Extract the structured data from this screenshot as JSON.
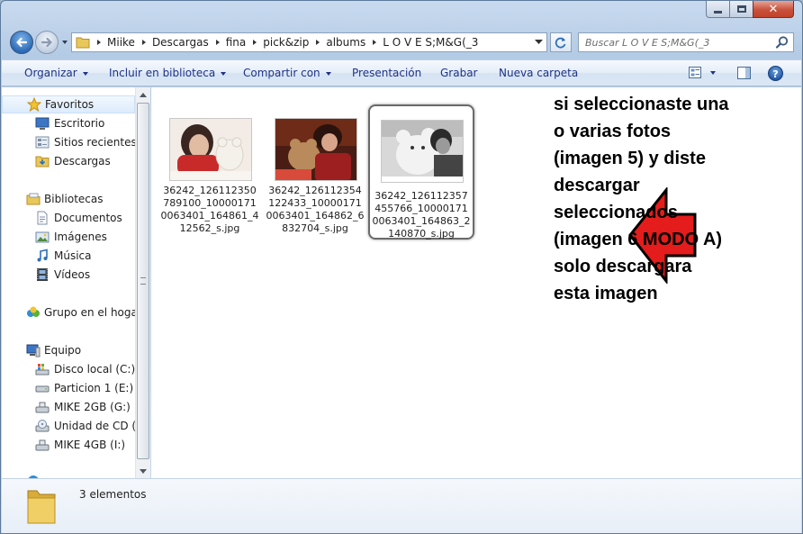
{
  "window": {
    "caption_buttons": {
      "minimize": "minimize",
      "maximize": "maximize",
      "close": "close"
    }
  },
  "navigation": {
    "breadcrumbs": [
      "Miike",
      "Descargas",
      "fina",
      "pick&zip",
      "albums",
      "L O V E S;M&G(_3"
    ],
    "search_placeholder": "Buscar L O V E S;M&G(_3"
  },
  "command_bar": {
    "organize": "Organizar",
    "include_in_library": "Incluir en biblioteca",
    "share_with": "Compartir con",
    "slideshow": "Presentación",
    "burn": "Grabar",
    "new_folder": "Nueva carpeta"
  },
  "sidebar": {
    "favorites": {
      "header": "Favoritos",
      "items": [
        "Escritorio",
        "Sitios recientes",
        "Descargas"
      ]
    },
    "libraries": {
      "header": "Bibliotecas",
      "items": [
        "Documentos",
        "Imágenes",
        "Música",
        "Vídeos"
      ]
    },
    "homegroup": "Grupo en el hogar",
    "computer": {
      "header": "Equipo",
      "items": [
        "Disco local (C:)",
        "Particion 1 (E:)",
        "MIKE 2GB (G:)",
        "Unidad de CD (H",
        "MIKE 4GB (I:)"
      ]
    }
  },
  "files": [
    {
      "name": "36242_126112350789100_100001710063401_164861_412562_s.jpg",
      "selected": false
    },
    {
      "name": "36242_126112354122433_100001710063401_164862_6832704_s.jpg",
      "selected": false
    },
    {
      "name": "36242_126112357455766_100001710063401_164863_2140870_s.jpg",
      "selected": true
    }
  ],
  "annotation": {
    "lines": [
      "si seleccionaste una",
      "o varias fotos",
      "(imagen 5) y diste",
      "descargar",
      "seleccionados",
      "(imagen 6 MODO A)",
      "solo descargara",
      "esta imagen"
    ]
  },
  "details": {
    "count": "3 elementos"
  },
  "colors": {
    "arrow_fill": "#e41c1c",
    "arrow_outline": "#000000",
    "command_text": "#1e3287",
    "selection_border": "#6a6a6a"
  }
}
